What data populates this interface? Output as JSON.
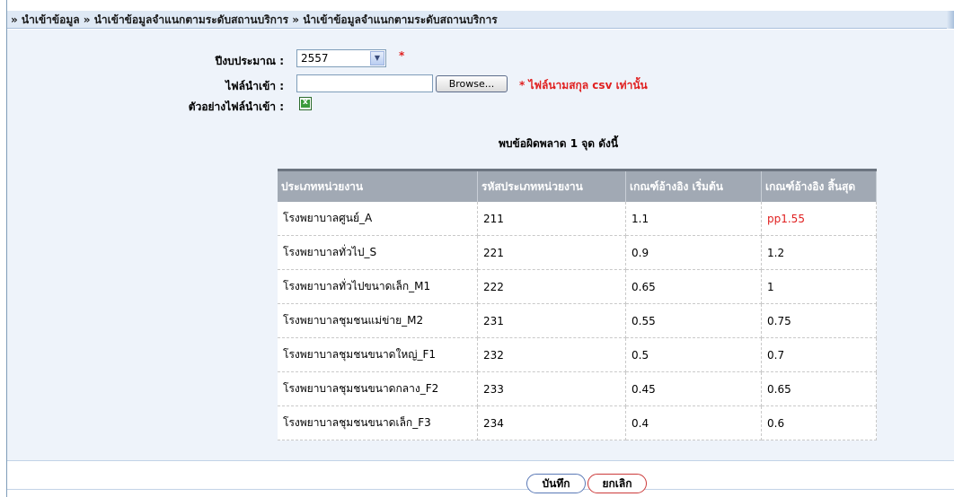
{
  "breadcrumb": "» นำเข้าข้อมูล » นำเข้าข้อมูลจำแนกตามระดับสถานบริการ » นำเข้าข้อมูลจำแนกตามระดับสถานบริการ",
  "form": {
    "year_label": "ปีงบประมาณ :",
    "year_value": "2557",
    "required_mark": "*",
    "file_label": "ไฟล์นำเข้า :",
    "browse_label": "Browse...",
    "file_note": "* ไฟล์นามสกุล csv เท่านั้น",
    "sample_label": "ตัวอย่างไฟล์นำเข้า :"
  },
  "error_title": "พบข้อผิดพลาด 1 จุด ดังนี้",
  "table": {
    "headers": [
      "ประเภทหน่วยงาน",
      "รหัสประเภทหน่วยงาน",
      "เกณฑ์อ้างอิง เริ่มต้น",
      "เกณฑ์อ้างอิง สิ้นสุด"
    ],
    "rows": [
      [
        "โรงพยาบาลศูนย์_A",
        "211",
        "1.1",
        "pp1.55"
      ],
      [
        "โรงพยาบาลทั่วไป_S",
        "221",
        "0.9",
        "1.2"
      ],
      [
        "โรงพยาบาลทั่วไปขนาดเล็ก_M1",
        "222",
        "0.65",
        "1"
      ],
      [
        "โรงพยาบาลชุมชนแม่ข่าย_M2",
        "231",
        "0.55",
        "0.75"
      ],
      [
        "โรงพยาบาลชุมชนขนาดใหญ่_F1",
        "232",
        "0.5",
        "0.7"
      ],
      [
        "โรงพยาบาลชุมชนขนาดกลาง_F2",
        "233",
        "0.45",
        "0.65"
      ],
      [
        "โรงพยาบาลชุมชนขนาดเล็ก_F3",
        "234",
        "0.4",
        "0.6"
      ]
    ]
  },
  "buttons": {
    "save": "บันทึก",
    "cancel": "ยกเลิก"
  },
  "colors": {
    "error": "#e02020",
    "header_bg": "#a1a9b4",
    "panel_bg": "#eef3fa"
  },
  "icons": {
    "dropdown": "chevron-down-icon",
    "sample_file": "excel-file-icon"
  }
}
